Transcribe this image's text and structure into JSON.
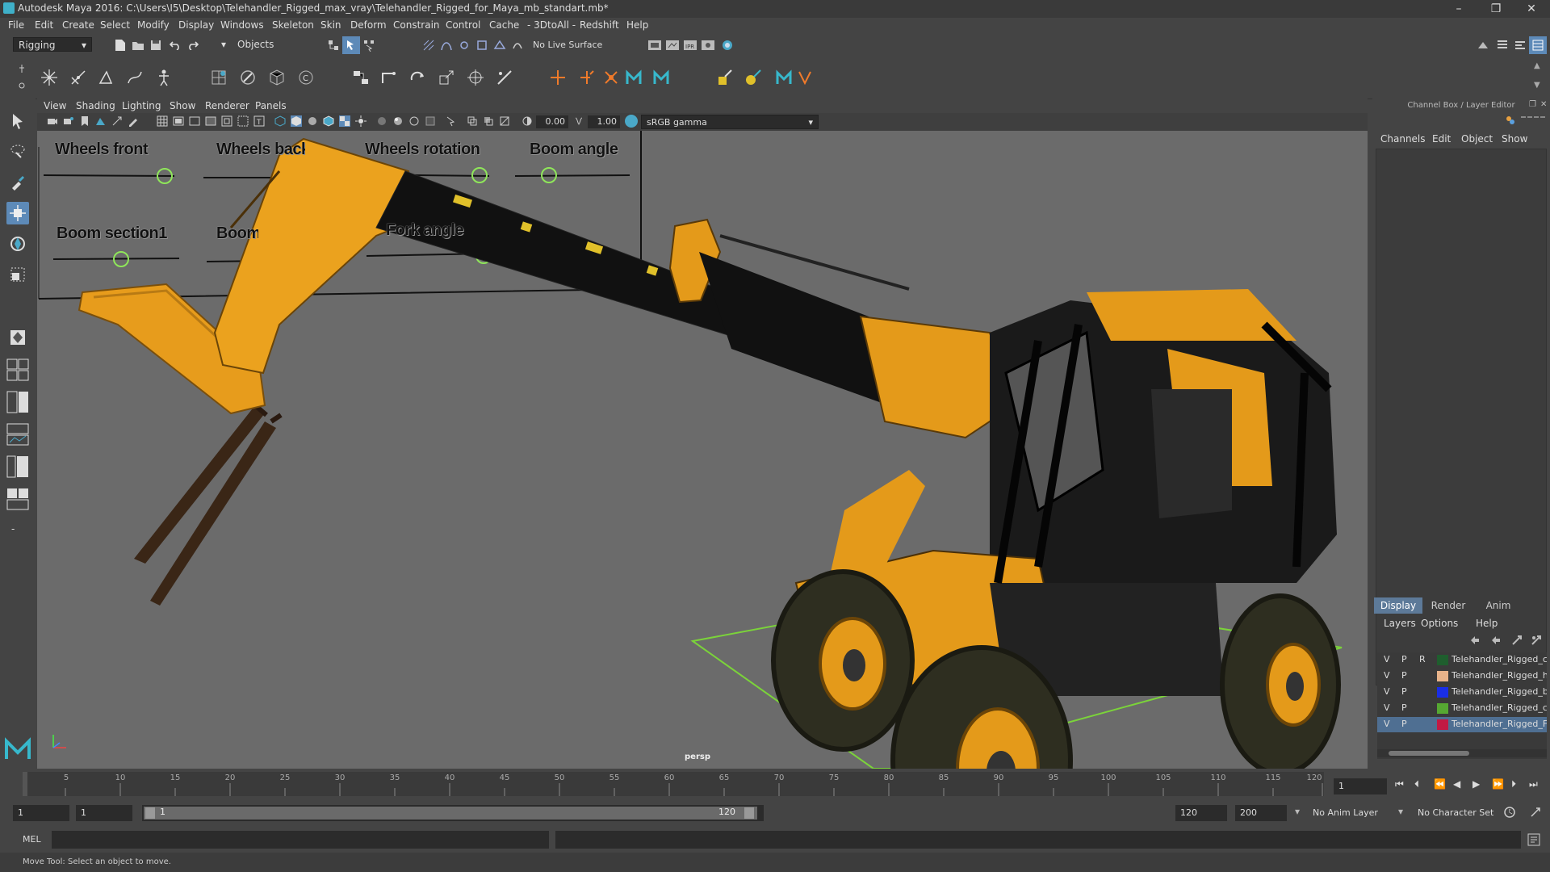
{
  "window": {
    "title": "Autodesk Maya 2016: C:\\Users\\I5\\Desktop\\Telehandler_Rigged_max_vray\\Telehandler_Rigged_for_Maya_mb_standart.mb*",
    "minimize": "–",
    "maximize": "❐",
    "close": "✕"
  },
  "menus": [
    "File",
    "Edit",
    "Create",
    "Select",
    "Modify",
    "Display",
    "Windows",
    "Skeleton",
    "Skin",
    "Deform",
    "Constrain",
    "Control",
    "Cache",
    "- 3DtoAll -",
    "Redshift",
    "Help"
  ],
  "status_line": {
    "mode": "Rigging",
    "selection_mask": "Objects",
    "live_surface": "No Live Surface"
  },
  "panel": {
    "menus": [
      "View",
      "Shading",
      "Lighting",
      "Show",
      "Renderer",
      "Panels"
    ],
    "exposure": "0.00",
    "gamma": "1.00",
    "color_space": "sRGB gamma",
    "camera": "persp"
  },
  "rig_ui": {
    "labels": [
      "Wheels front",
      "Wheels back",
      "Wheels rotation",
      "Boom angle",
      "Boom section1",
      "Boom section2",
      "Fork angle"
    ]
  },
  "channel_box": {
    "header": "Channel Box / Layer Editor",
    "tabs": [
      "Channels",
      "Edit",
      "Object",
      "Show"
    ]
  },
  "layer_editor": {
    "tabs": [
      "Display",
      "Render",
      "Anim"
    ],
    "menus": [
      "Layers",
      "Options",
      "Help"
    ],
    "layers": [
      {
        "v": "V",
        "p": "P",
        "r": "R",
        "color": "#1f5e2e",
        "name": "Telehandler_Rigged_controls"
      },
      {
        "v": "V",
        "p": "P",
        "r": "",
        "color": "#e8b38a",
        "name": "Telehandler_Rigged_helpers"
      },
      {
        "v": "V",
        "p": "P",
        "r": "",
        "color": "#1a2ee6",
        "name": "Telehandler_Rigged_bones"
      },
      {
        "v": "V",
        "p": "P",
        "r": "",
        "color": "#56a832",
        "name": "Telehandler_Rigged_controllers"
      },
      {
        "v": "V",
        "p": "P",
        "r": "",
        "color": "#c21a44",
        "name": "Telehandler_Rigged_FBX"
      }
    ]
  },
  "timeline": {
    "ticks": [
      "1",
      "5",
      "10",
      "15",
      "20",
      "25",
      "30",
      "35",
      "40",
      "45",
      "50",
      "55",
      "60",
      "65",
      "70",
      "75",
      "80",
      "85",
      "90",
      "95",
      "100",
      "105",
      "110",
      "115",
      "120"
    ],
    "current_frame": "1",
    "current_frame_field": "1"
  },
  "range": {
    "start": "1",
    "playback_start": "1",
    "slider_start": "1",
    "slider_end": "120",
    "playback_end": "120",
    "end": "200",
    "anim_layer": "No Anim Layer",
    "character_set": "No Character Set"
  },
  "command": {
    "lang": "MEL"
  },
  "help_line": "Move Tool: Select an object to move."
}
